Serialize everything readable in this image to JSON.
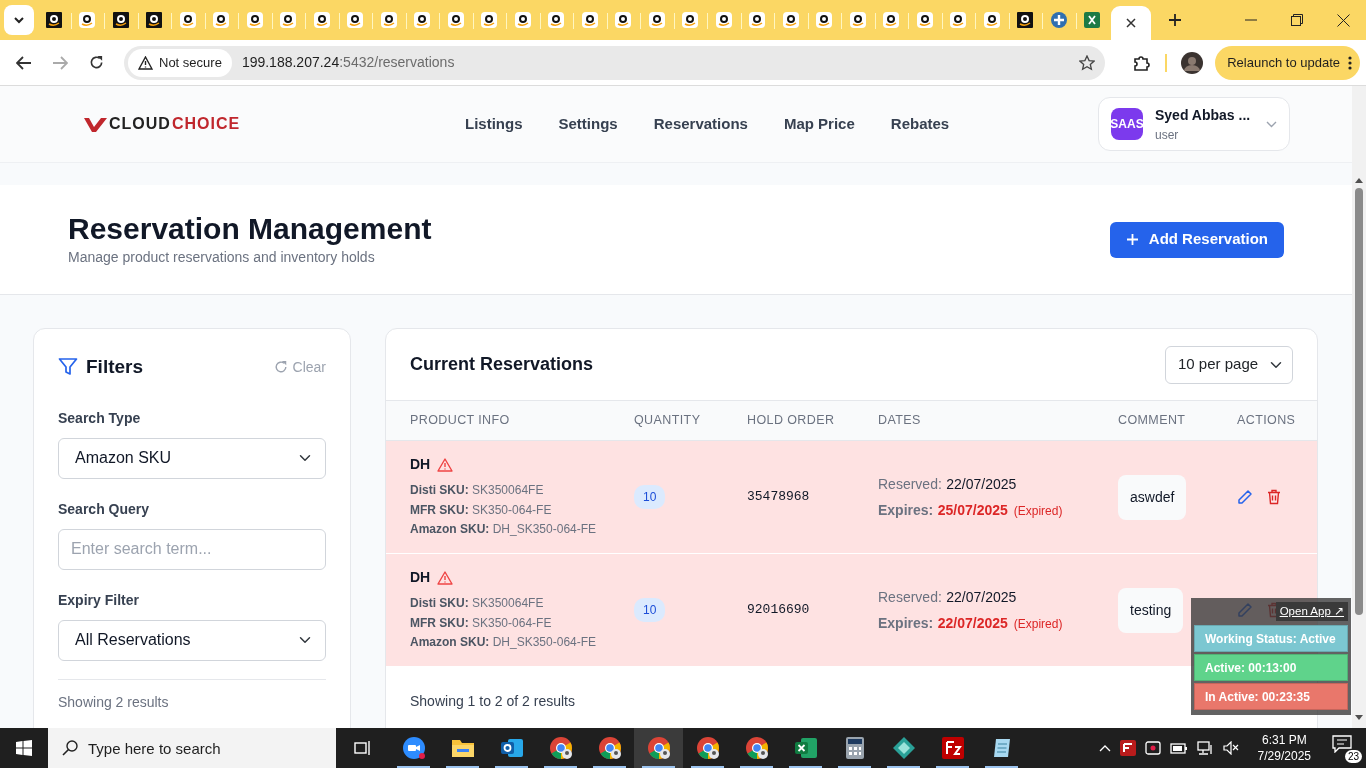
{
  "browser": {
    "tabs": [
      {
        "kind": "a-dark",
        "selected": false
      },
      {
        "kind": "a-light",
        "selected": false
      },
      {
        "kind": "a-dark",
        "selected": false
      },
      {
        "kind": "a-dark",
        "selected": false
      },
      {
        "kind": "a-light",
        "selected": false
      },
      {
        "kind": "a-light",
        "selected": false
      },
      {
        "kind": "a-light",
        "selected": false
      },
      {
        "kind": "a-light",
        "selected": false
      },
      {
        "kind": "a-light",
        "selected": false
      },
      {
        "kind": "a-light",
        "selected": false
      },
      {
        "kind": "a-light",
        "selected": false
      },
      {
        "kind": "a-light",
        "selected": false
      },
      {
        "kind": "a-light",
        "selected": false
      },
      {
        "kind": "a-light",
        "selected": false
      },
      {
        "kind": "a-light",
        "selected": false
      },
      {
        "kind": "a-light",
        "selected": false
      },
      {
        "kind": "a-light",
        "selected": false
      },
      {
        "kind": "a-light",
        "selected": false
      },
      {
        "kind": "a-light",
        "selected": false
      },
      {
        "kind": "a-light",
        "selected": false
      },
      {
        "kind": "a-light",
        "selected": false
      },
      {
        "kind": "a-light",
        "selected": false
      },
      {
        "kind": "a-light",
        "selected": false
      },
      {
        "kind": "a-light",
        "selected": false
      },
      {
        "kind": "a-light",
        "selected": false
      },
      {
        "kind": "a-light",
        "selected": false
      },
      {
        "kind": "a-light",
        "selected": false
      },
      {
        "kind": "a-light",
        "selected": false
      },
      {
        "kind": "a-light",
        "selected": false
      },
      {
        "kind": "a-dark",
        "selected": false
      },
      {
        "kind": "round-app",
        "selected": false
      },
      {
        "kind": "spreadsheet",
        "selected": false
      },
      {
        "kind": "blank",
        "selected": true
      }
    ],
    "security": "Not secure",
    "url_host": "199.188.207.24",
    "url_path": ":5432/reservations",
    "relaunch": "Relaunch to update"
  },
  "app": {
    "logo": {
      "first": "CLOUD",
      "second": "CHOICE"
    },
    "nav": [
      "Listings",
      "Settings",
      "Reservations",
      "Map Price",
      "Rebates"
    ],
    "user": {
      "avatar": "SAAS",
      "name": "Syed Abbas ...",
      "role": "user"
    },
    "title": "Reservation Management",
    "subtitle": "Manage product reservations and inventory holds",
    "add_button": "Add Reservation",
    "filters": {
      "title": "Filters",
      "clear": "Clear",
      "search_type_label": "Search Type",
      "search_type": "Amazon SKU",
      "query_label": "Search Query",
      "query_placeholder": "Enter search term...",
      "expiry_label": "Expiry Filter",
      "expiry": "All Reservations",
      "count": "Showing 2 results"
    },
    "reservations": {
      "title": "Current Reservations",
      "per_page": "10 per page",
      "columns": [
        "PRODUCT INFO",
        "QUANTITY",
        "HOLD ORDER",
        "DATES",
        "COMMENT",
        "ACTIONS"
      ],
      "rows": [
        {
          "expired": true,
          "product": "DH",
          "details": [
            "**Disti SKU:** SK350064FE",
            "**MFR SKU:** SK350-064-FE",
            "**Amazon SKU:** DH_SK350-064-FE"
          ],
          "quantity": "10",
          "hold_order": "35478968",
          "reserved_label": "Reserved:",
          "reserved": "22/07/2025",
          "expires_label": "Expires:",
          "expires": "25/07/2025",
          "status": "(Expired)",
          "comment": "aswdef"
        },
        {
          "expired": true,
          "product": "DH",
          "details": [
            "**Disti SKU:** SK350064FE",
            "**MFR SKU:** SK350-064-FE",
            "**Amazon SKU:** DH_SK350-064-FE"
          ],
          "quantity": "10",
          "hold_order": "92016690",
          "reserved_label": "Reserved:",
          "reserved": "22/07/2025",
          "expires_label": "Expires:",
          "expires": "22/07/2025",
          "status": "(Expired)",
          "comment": "testing"
        }
      ],
      "footer": "Showing 1 to 2 of 2 results"
    }
  },
  "tracker": {
    "link": "Open App ↗",
    "items": [
      {
        "text": "Working Status: Active",
        "color": "#7cc7d1"
      },
      {
        "text": "Active: 00:13:00",
        "color": "#5fd38b"
      },
      {
        "text": "In Active: 00:23:35",
        "color": "#e9776b"
      }
    ]
  },
  "taskbar": {
    "search_placeholder": "Type here to search",
    "apps": [
      {
        "kind": "video",
        "selected": false
      },
      {
        "kind": "folder",
        "selected": false
      },
      {
        "kind": "mail",
        "selected": false
      },
      {
        "kind": "browser",
        "selected": false
      },
      {
        "kind": "browser",
        "selected": false
      },
      {
        "kind": "browser",
        "selected": true
      },
      {
        "kind": "browser",
        "selected": false
      },
      {
        "kind": "browser",
        "selected": false
      },
      {
        "kind": "sheet",
        "selected": false
      },
      {
        "kind": "calculator",
        "selected": false
      },
      {
        "kind": "diamond",
        "selected": false
      },
      {
        "kind": "transfer",
        "selected": false
      },
      {
        "kind": "notepad",
        "selected": false
      }
    ],
    "time": "6:31 PM",
    "date": "7/29/2025",
    "notifications": "23"
  }
}
